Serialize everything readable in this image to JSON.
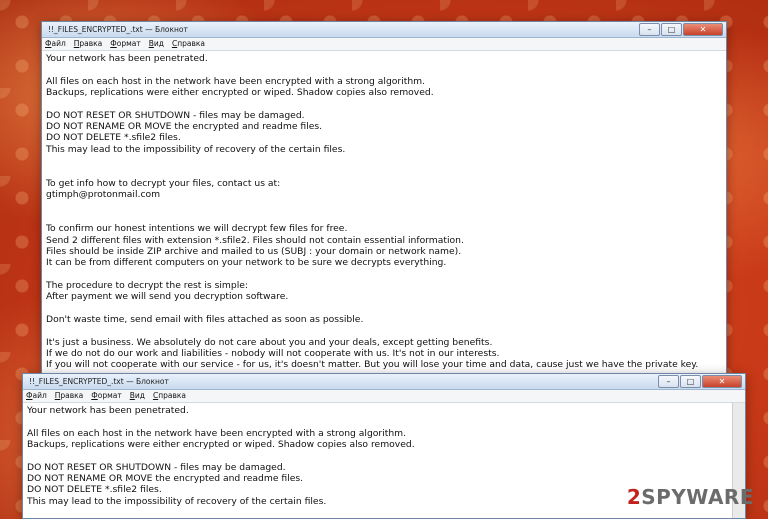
{
  "notepad_top": {
    "title": "!!_FILES_ENCRYPTED_.txt — Блокнот",
    "menu": [
      "Файл",
      "Правка",
      "Формат",
      "Вид",
      "Справка"
    ],
    "controls": [
      "–",
      "□",
      "✕"
    ],
    "lines": [
      "Your network has been penetrated.",
      "",
      "All files on each host in the network have been encrypted with a strong algorithm.",
      "Backups, replications were either encrypted or wiped. Shadow copies also removed.",
      "",
      "DO NOT RESET OR SHUTDOWN - files may be damaged.",
      "DO NOT RENAME OR MOVE the encrypted and readme files.",
      "DO NOT DELETE *.sfile2 files.",
      "This may lead to the impossibility of recovery of the certain files.",
      "",
      "",
      "To get info how to decrypt your files, contact us at:",
      "gtimph@protonmail.com",
      "",
      "",
      "To confirm our honest intentions we will decrypt few files for free.",
      "Send 2 different files with extension *.sfile2. Files should not contain essential information.",
      "Files should be inside ZIP archive and mailed to us (SUBJ : your domain or network name).",
      "It can be from different computers on your network to be sure we decrypts everything.",
      "",
      "The procedure to decrypt the rest is simple:",
      "After payment we will send you decryption software.",
      "",
      "Don't waste time, send email with files attached as soon as possible.",
      "",
      "It's just a business. We absolutely do not care about you and your deals, except getting benefits.",
      "If we do not do our work and liabilities - nobody will not cooperate with us. It's not in our interests.",
      "If you will not cooperate with our service - for us, it's doesn't matter. But you will lose your time and data, cause just we have the private key."
    ]
  },
  "notepad_bottom": {
    "title": "!!_FILES_ENCRYPTED_.txt — Блокнот",
    "menu": [
      "Файл",
      "Правка",
      "Формат",
      "Вид",
      "Справка"
    ],
    "controls": [
      "–",
      "□",
      "✕"
    ],
    "lines": [
      "Your network has been penetrated.",
      "",
      "All files on each host in the network have been encrypted with a strong algorithm.",
      "Backups, replications were either encrypted or wiped. Shadow copies also removed.",
      "",
      "DO NOT RESET OR SHUTDOWN - files may be damaged.",
      "DO NOT RENAME OR MOVE the encrypted and readme files.",
      "DO NOT DELETE *.sfile2 files.",
      "This may lead to the impossibility of recovery of the certain files."
    ]
  },
  "watermark": {
    "prefix": "2",
    "text": "SPYWARE"
  },
  "colors": {
    "background": "#c93a18",
    "watermark_accent": "#c2241d"
  }
}
